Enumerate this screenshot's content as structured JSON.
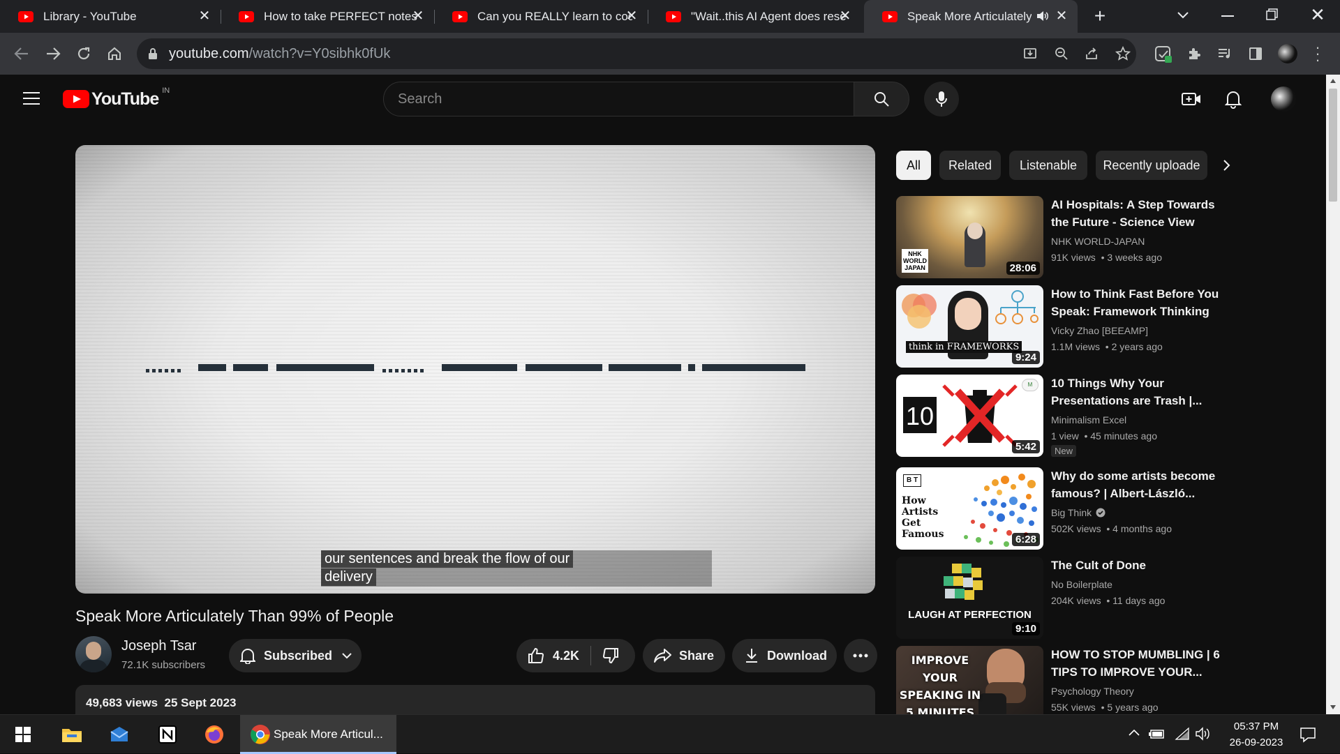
{
  "browser": {
    "tabs": [
      {
        "title": "Library - YouTube"
      },
      {
        "title": "How to take PERFECT notes w"
      },
      {
        "title": "Can you REALLY learn to code"
      },
      {
        "title": "\"Wait..this AI Agent does rese"
      },
      {
        "title": "Speak More Articulately T"
      }
    ],
    "url_host": "youtube.com",
    "url_path": "/watch?v=Y0sibhk0fUk"
  },
  "youtube": {
    "logo_text": "YouTube",
    "region": "IN",
    "search_placeholder": "Search"
  },
  "video": {
    "caption_line1": "our sentences and break the flow of our",
    "caption_line2": "delivery",
    "title": "Speak More Articulately Than 99% of People",
    "channel_name": "Joseph Tsar",
    "subscribers": "72.1K subscribers",
    "subscribe_label": "Subscribed",
    "likes": "4.2K",
    "share_label": "Share",
    "download_label": "Download",
    "views": "49,683 views",
    "date": "25 Sept 2023"
  },
  "chips": [
    "All",
    "Related",
    "Listenable",
    "Recently uploade"
  ],
  "recommendations": [
    {
      "title": "AI Hospitals: A Step Towards the Future - Science View",
      "channel": "NHK WORLD-JAPAN",
      "views": "91K views",
      "age": "3 weeks ago",
      "duration": "28:06",
      "thumb_text": "NHK WORLD JAPAN"
    },
    {
      "title": "How to Think Fast Before You Speak: Framework Thinking",
      "channel": "Vicky Zhao [BEEAMP]",
      "views": "1.1M views",
      "age": "2 years ago",
      "duration": "9:24",
      "thumb_text": "think in FRAMEWORKS"
    },
    {
      "title": "10 Things Why Your Presentations are Trash |...",
      "channel": "Minimalism Excel",
      "views": "1 view",
      "age": "45 minutes ago",
      "duration": "5:42",
      "badge": "New",
      "thumb_text": "10"
    },
    {
      "title": "Why do some artists become famous? | Albert-László...",
      "channel": "Big Think",
      "views": "502K views",
      "age": "4 months ago",
      "duration": "6:28",
      "thumb_text": "How Artists Get Famous"
    },
    {
      "title": "The Cult of Done",
      "channel": "No Boilerplate",
      "views": "204K views",
      "age": "11 days ago",
      "duration": "9:10",
      "thumb_text": "LAUGH AT PERFECTION"
    },
    {
      "title": "HOW TO STOP MUMBLING | 6 TIPS TO IMPROVE YOUR...",
      "channel": "Psychology Theory",
      "views": "55K views",
      "age": "5 years ago",
      "duration": "",
      "thumb_text": "IMPROVE YOUR SPEAKING IN 5 MINUTES"
    }
  ],
  "taskbar": {
    "active_app": "Speak More Articul...",
    "time": "05:37 PM",
    "date": "26-09-2023"
  },
  "colors": {
    "youtube_red": "#ff0000",
    "background": "#0f0f0f",
    "chip_selected": "#f1f1f1"
  }
}
